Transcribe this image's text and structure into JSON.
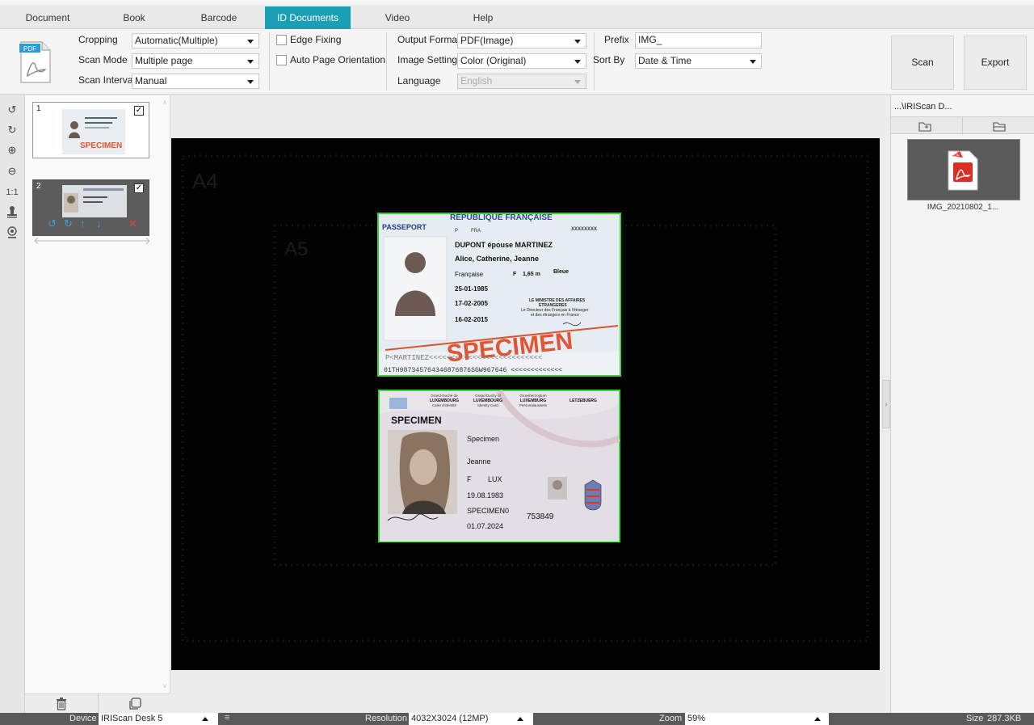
{
  "tabs": [
    "Document",
    "Book",
    "Barcode",
    "ID Documents",
    "Video",
    "Help"
  ],
  "active_tab": "ID Documents",
  "ribbon": {
    "cropping_label": "Cropping",
    "cropping_value": "Automatic(Multiple)",
    "scan_mode_label": "Scan Mode",
    "scan_mode_value": "Multiple page",
    "scan_interval_label": "Scan Interval",
    "scan_interval_value": "Manual",
    "edge_fixing_label": "Edge Fixing",
    "auto_orientation_label": "Auto Page Orientation",
    "output_format_label": "Output Format",
    "output_format_value": "PDF(Image)",
    "image_settings_label": "Image Settings",
    "image_settings_value": "Color (Original)",
    "language_label": "Language",
    "language_value": "English",
    "prefix_label": "Prefix",
    "prefix_value": "IMG_",
    "sort_by_label": "Sort By",
    "sort_by_value": "Date & Time",
    "scan_button": "Scan",
    "export_button": "Export",
    "pdf_badge": "PDF"
  },
  "thumbnails": [
    {
      "number": "1",
      "checked": "✓"
    },
    {
      "number": "2",
      "checked": "✓"
    }
  ],
  "viewer": {
    "ghost_a4": "A4",
    "ghost_a5": "A5",
    "passport": {
      "header": "RÉPUBLIQUE FRANÇAISE",
      "doc_type": "PASSEPORT",
      "type_line": "P",
      "country": "FRA",
      "passport_no": "XXXXXXXX",
      "surname": "DUPONT épouse MARTINEZ",
      "given_names": "Alice, Catherine, Jeanne",
      "nationality": "Française",
      "sex": "F",
      "height": "1,65 m",
      "eyes": "Bleue",
      "dob": "25-01-1985",
      "issue_date": "17-02-2005",
      "expiry_date": "16-02-2015",
      "authority_1": "LE MINISTRE DES AFFAIRES",
      "authority_2": "ETRANGERES",
      "authority_3": "Le Directeur des Français à l'étranger",
      "authority_4": "et des étrangers en France",
      "stamp": "SPECIMEN",
      "mrz_1": "P<MARTINEZ<<<<<<<<<<<<<<<<<<<<<<<<<<",
      "mrz_2": "01TH987345764346876876SGW967646 <<<<<<<<<<<<<"
    },
    "idcard": {
      "h1_a": "Grand-Duché de",
      "h1_b": "LUXEMBOURG",
      "h1_c": "Carte d'identité",
      "h2_a": "Grand Duchy of",
      "h2_b": "LUXEMBOURG",
      "h2_c": "Identity Card",
      "h3_a": "Grossherzogtum",
      "h3_b": "LUXEMBURG",
      "h3_c": "Personalausweis",
      "h4": "LETZEBUERG",
      "specimen": "SPECIMEN",
      "surname": "Specimen",
      "given": "Jeanne",
      "sex": "F",
      "nationality": "LUX",
      "dob": "19.08.1983",
      "card_no": "SPECIMEN0",
      "can": "753849",
      "expiry": "01.07.2024"
    }
  },
  "right_panel": {
    "path": "...\\IRIScan D...",
    "file_name": "IMG_20210802_1...",
    "pdf_badge": "PDF"
  },
  "status": {
    "device_label": "Device",
    "device_value": "IRIScan Desk 5",
    "resolution_label": "Resolution",
    "resolution_value": "4032X3024 (12MP)",
    "zoom_label": "Zoom",
    "zoom_value": "59%",
    "size_label": "Size",
    "size_value": "287.3KB"
  }
}
